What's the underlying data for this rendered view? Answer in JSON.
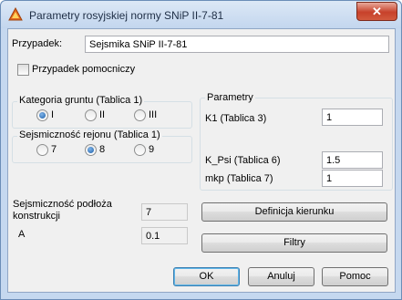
{
  "window": {
    "title": "Parametry rosyjskiej normy SNiP II-7-81",
    "close_glyph": "✕"
  },
  "case": {
    "label": "Przypadek:",
    "value": "Sejsmika SNiP II-7-81"
  },
  "auxiliary": {
    "label": "Przypadek pomocniczy",
    "checked": false
  },
  "soil_category": {
    "title": "Kategoria gruntu (Tablica 1)",
    "options": [
      {
        "label": "I",
        "selected": true
      },
      {
        "label": "II",
        "selected": false
      },
      {
        "label": "III",
        "selected": false
      }
    ]
  },
  "seismicity_region": {
    "title": "Sejsmiczność rejonu (Tablica 1)",
    "options": [
      {
        "label": "7",
        "selected": false
      },
      {
        "label": "8",
        "selected": true
      },
      {
        "label": "9",
        "selected": false
      }
    ]
  },
  "parameters": {
    "title": "Parametry",
    "k1": {
      "label": "K1 (Tablica 3)",
      "value": "1"
    },
    "kpsi": {
      "label": "K_Psi (Tablica 6)",
      "value": "1.5"
    },
    "mkp": {
      "label": "mkp (Tablica 7)",
      "value": "1"
    }
  },
  "base_seismicity": {
    "label": "Sejsmiczność podłoża konstrukcji",
    "value": "7"
  },
  "a": {
    "label": "A",
    "value": "0.1"
  },
  "buttons": {
    "direction": "Definicja kierunku",
    "filters": "Filtry",
    "ok": "OK",
    "cancel": "Anuluj",
    "help": "Pomoc"
  }
}
